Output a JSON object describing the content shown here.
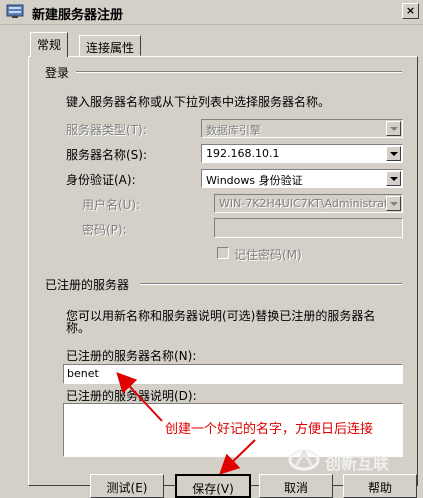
{
  "window": {
    "title": "新建服务器注册",
    "close_glyph": "×"
  },
  "tabs": [
    {
      "label": "常规",
      "active": true
    },
    {
      "label": "连接属性",
      "active": false
    }
  ],
  "login": {
    "group_title": "登录",
    "instruction": "键入服务器名称或从下拉列表中选择服务器名称。",
    "server_type": {
      "label": "服务器类型(T):",
      "value": "数据库引擎"
    },
    "server_name": {
      "label": "服务器名称(S):",
      "value": "192.168.10.1"
    },
    "authentication": {
      "label": "身份验证(A):",
      "value": "Windows 身份验证"
    },
    "username": {
      "label": "用户名(U):",
      "value": "WIN-7K2H4UIC7KT\\Administrato"
    },
    "password": {
      "label": "密码(P):",
      "value": ""
    },
    "remember_password": {
      "label": "记住密码(M)",
      "checked": false
    }
  },
  "registered": {
    "group_title": "已注册的服务器",
    "description_line1": "您可以用新名称和服务器说明(可选)替换已注册的服务器名",
    "description_line2": "称。",
    "name_label": "已注册的服务器名称(N):",
    "name_value": "benet",
    "desc_label": "已注册的服务器说明(D):",
    "desc_value": ""
  },
  "annotation": {
    "text": "创建一个好记的名字，方便日后连接",
    "color": "#e00000"
  },
  "buttons": {
    "test": "测试(E)",
    "save": "保存(V)",
    "cancel": "取消",
    "help": "帮助"
  },
  "watermark": {
    "text": "创新互联"
  }
}
